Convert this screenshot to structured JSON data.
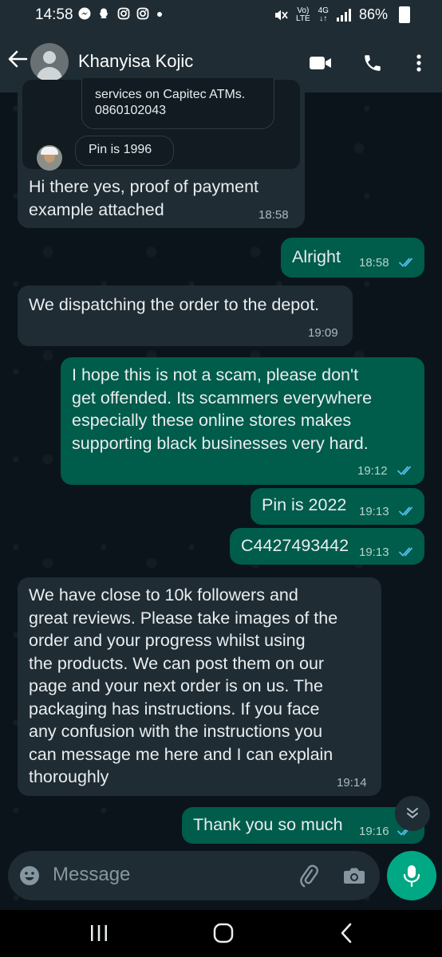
{
  "status_bar": {
    "time": "14:58",
    "notif_icons": [
      "messenger-icon",
      "snapchat-icon",
      "instagram-icon",
      "instagram-icon"
    ],
    "volte_top": "Vo)",
    "volte_bottom": "LTE",
    "network": "4G",
    "battery": "86%"
  },
  "header": {
    "contact_name": "Khanyisa Kojic"
  },
  "messages": {
    "quoted_partial": "services on Capitec ATMs.",
    "quoted_number": "0860102043",
    "quoted_pin": "Pin is 1996",
    "m1": {
      "text": "Hi there yes, proof of payment\nexample attached",
      "time": "18:58"
    },
    "m2": {
      "text": "Alright",
      "time": "18:58"
    },
    "m3": {
      "text": "We dispatching the order to the depot.",
      "time": "19:09"
    },
    "m4": {
      "text": "I hope this is not a scam, please don't\nget offended. Its scammers everywhere\nespecially these online stores makes\nsupporting black businesses very hard.",
      "time": "19:12"
    },
    "m5": {
      "text": "Pin is 2022",
      "time": "19:13"
    },
    "m6": {
      "text": "C4427493442",
      "time": "19:13"
    },
    "m7": {
      "text": "We have close to 10k followers and\ngreat reviews. Please take images of the\norder and your progress whilst using\nthe products. We can post them on our\npage and your next order is on us. The\npackaging has instructions. If you face\nany confusion with the instructions you\ncan message me here and I can explain\nthoroughly",
      "time": "19:14"
    },
    "m8": {
      "text": "Thank you so much",
      "time": "19:16"
    }
  },
  "input": {
    "placeholder": "Message"
  },
  "colors": {
    "outgoing_bubble": "#005c4b",
    "incoming_bubble": "#1f2c33",
    "accent": "#00a884",
    "read_ticks": "#53bdeb"
  }
}
